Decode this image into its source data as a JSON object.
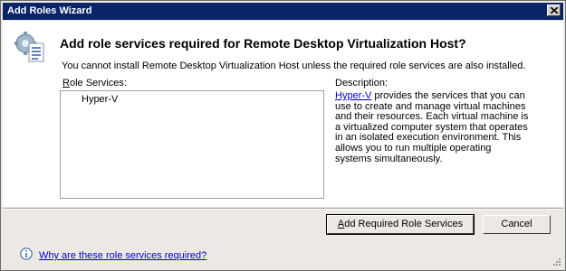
{
  "window": {
    "title": "Add Roles Wizard"
  },
  "dialog": {
    "heading": "Add role services required for Remote Desktop Virtualization Host?",
    "subtext": "You cannot install Remote Desktop Virtualization Host unless the required role services are also installed.",
    "role_services_label_hotkey": "R",
    "role_services_label_rest": "ole Services:",
    "role_services": [
      {
        "label": "Hyper-V"
      }
    ],
    "description_label": "Description:",
    "description_link": "Hyper-V",
    "description_text": " provides the services that you can use to create and manage virtual machines and their resources. Each virtual machine is a virtualized computer system that operates in an isolated execution environment. This allows you to run multiple operating systems simultaneously."
  },
  "buttons": {
    "add_hotkey": "A",
    "add_rest": "dd Required Role Services",
    "cancel": "Cancel"
  },
  "footer": {
    "help_link": "Why are these role services required?"
  }
}
